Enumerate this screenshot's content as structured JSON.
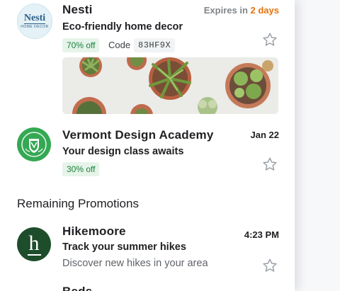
{
  "colors": {
    "expires_accent": "#e8710a",
    "chip_green_bg": "#e6f4ea",
    "chip_green_fg": "#188038",
    "nesti_avatar_bg": "#e4f1f7",
    "vermont_avatar_bg": "#34a853",
    "hikemoore_avatar_bg": "#1e4d2b"
  },
  "emails": [
    {
      "avatar_text": "Nesti",
      "avatar_subtext": "HOME DECOR",
      "sender": "Nesti",
      "expires_prefix": "Expires in ",
      "expires_value": "2 days",
      "subject": "Eco-friendly home decor",
      "discount": "70% off",
      "code_label": "Code",
      "code": "83HF9X",
      "image": "succulent-plants-photo"
    },
    {
      "sender": "Vermont Design Academy",
      "date": "Jan 22",
      "subject": "Your design class awaits",
      "discount": "30% off"
    }
  ],
  "section_title": "Remaining Promotions",
  "remaining": [
    {
      "avatar_letter": "h",
      "sender": "Hikemoore",
      "time": "4:23 PM",
      "subject": "Track your summer hikes",
      "snippet": "Discover new hikes in your area"
    }
  ],
  "partial_next_sender": "Beds"
}
